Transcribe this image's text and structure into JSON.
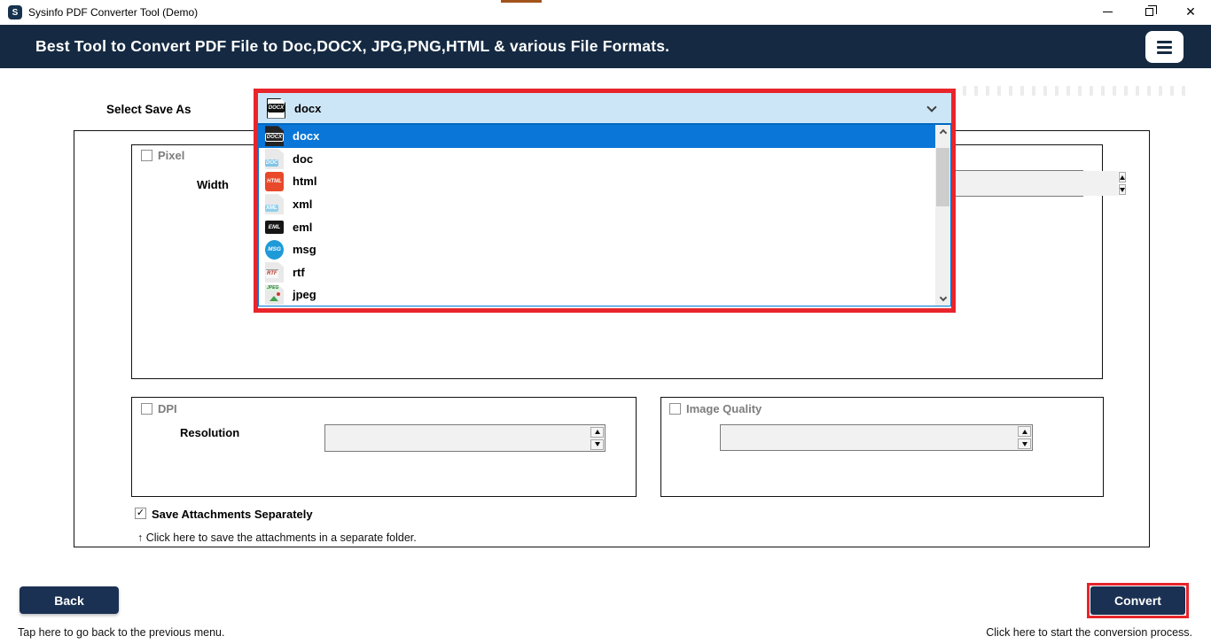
{
  "window": {
    "title": "Sysinfo PDF Converter Tool (Demo)",
    "app_icon_letter": "S"
  },
  "header": {
    "title": "Best Tool to Convert PDF File to Doc,DOCX, JPG,PNG,HTML & various File Formats."
  },
  "colors": {
    "header_navy": "#152a42",
    "button_navy": "#1b3153",
    "selection_blue": "#0a76d8",
    "combobox_blue": "#cde6f7",
    "combobox_border_blue": "#0067c0",
    "highlight_red": "#e8252b"
  },
  "save_as": {
    "label": "Select Save As",
    "selected_label": "docx",
    "selected_badge": "DOCX",
    "options": [
      {
        "label": "docx",
        "badge": "DOCX"
      },
      {
        "label": "doc",
        "badge": "DOC"
      },
      {
        "label": "html",
        "badge": "HTML"
      },
      {
        "label": "xml",
        "badge": "XML"
      },
      {
        "label": "eml",
        "badge": "EML"
      },
      {
        "label": "msg",
        "badge": "MSG"
      },
      {
        "label": "rtf",
        "badge": "RTF"
      },
      {
        "label": "jpeg",
        "badge": "JPEG"
      }
    ]
  },
  "pixel_panel": {
    "checkbox_label": "Pixel",
    "checked": false,
    "width_label": "Width",
    "width_value": ""
  },
  "dpi_panel": {
    "checkbox_label": "DPI",
    "checked": false,
    "resolution_label": "Resolution",
    "resolution_value": ""
  },
  "quality_panel": {
    "checkbox_label": "Image Quality",
    "checked": false,
    "value": ""
  },
  "attachments": {
    "checkbox_label": "Save Attachments Separately",
    "checked": true,
    "check_glyph": "✓",
    "hint": "↑ Click here to save the attachments in a separate folder."
  },
  "footer": {
    "back_label": "Back",
    "back_hint": "Tap here to go back to the previous menu.",
    "convert_label": "Convert",
    "convert_hint": "Click here to start the conversion process."
  },
  "icons": {
    "minimize": "minimize-icon",
    "restore": "restore-icon",
    "close": "close-icon",
    "close_glyph": "✕",
    "hamburger": "hamburger-menu-icon",
    "chevron_down": "chevron-down-icon",
    "chevron_up": "chevron-up-icon",
    "spinner_up": "spinner-up-icon",
    "spinner_down": "spinner-down-icon"
  }
}
